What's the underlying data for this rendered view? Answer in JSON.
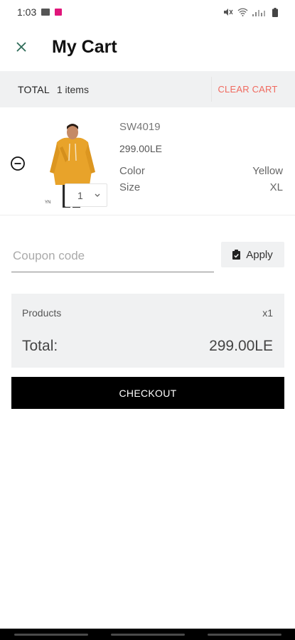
{
  "status_bar": {
    "time": "1:03"
  },
  "header": {
    "title": "My Cart"
  },
  "summary_bar": {
    "total_label": "TOTAL",
    "item_count": "1 items",
    "clear_label": "CLEAR CART"
  },
  "cart": {
    "items": [
      {
        "sku": "SW4019",
        "price": "299.00LE",
        "quantity": "1",
        "attributes": [
          {
            "label": "Color",
            "value": "Yellow"
          },
          {
            "label": "Size",
            "value": "XL"
          }
        ]
      }
    ]
  },
  "coupon": {
    "placeholder": "Coupon code",
    "value": "",
    "apply_label": "Apply"
  },
  "order_summary": {
    "products_label": "Products",
    "products_qty": "x1",
    "total_label": "Total:",
    "total_value": "299.00LE"
  },
  "checkout": {
    "label": "CHECKOUT"
  },
  "colors": {
    "accent_clear": "#f06a5f",
    "checkout_bg": "#000000",
    "panel_bg": "#f0f1f2",
    "product_yellow": "#e8a32a"
  },
  "icons": [
    "image-icon",
    "notification-icon",
    "mute-icon",
    "wifi-icon",
    "signal-icon",
    "battery-icon",
    "close-icon",
    "remove-circle-icon",
    "chevron-down-icon",
    "clipboard-check-icon"
  ]
}
